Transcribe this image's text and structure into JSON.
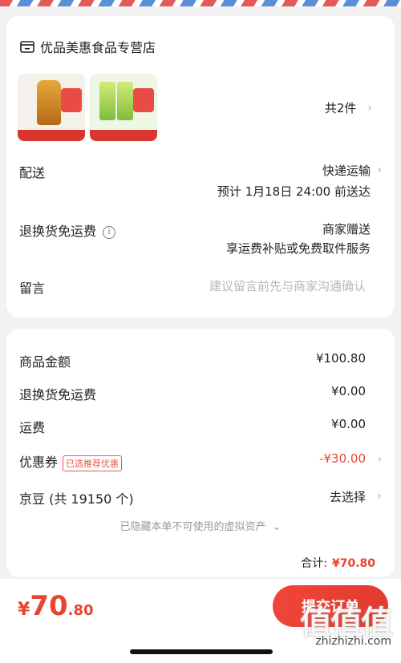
{
  "store": {
    "name": "优品美惠食品专营店",
    "icon": "store-icon"
  },
  "products": {
    "count_text": "共2件"
  },
  "delivery": {
    "label": "配送",
    "method": "快递运输",
    "eta": "预计 1月18日 24:00 前送达"
  },
  "return_insurance": {
    "label": "退换货免运费",
    "value_line1": "商家赠送",
    "value_line2": "享运费补贴或免费取件服务"
  },
  "message": {
    "label": "留言",
    "placeholder": "建议留言前先与商家沟通确认"
  },
  "summary": {
    "goods_amount_label": "商品金额",
    "goods_amount": "¥100.80",
    "return_fee_label": "退换货免运费",
    "return_fee": "¥0.00",
    "shipping_label": "运费",
    "shipping": "¥0.00",
    "coupon_label": "优惠券",
    "coupon_tag": "已选推荐优惠",
    "coupon_value": "-¥30.00",
    "beans_label": "京豆 (共 19150 个)",
    "beans_action": "去选择",
    "hidden_note": "已隐藏本单不可使用的虚拟资产",
    "total_label": "合计:",
    "total": "¥70.80"
  },
  "bottom": {
    "yen": "¥",
    "price_int": "70",
    "price_dec": ".80",
    "submit_label": "提交订单"
  },
  "watermark": {
    "logo": "值值值",
    "url": "zhizhizhi.com"
  },
  "colors": {
    "accent": "#e8452f",
    "background": "#f2f2f2"
  }
}
